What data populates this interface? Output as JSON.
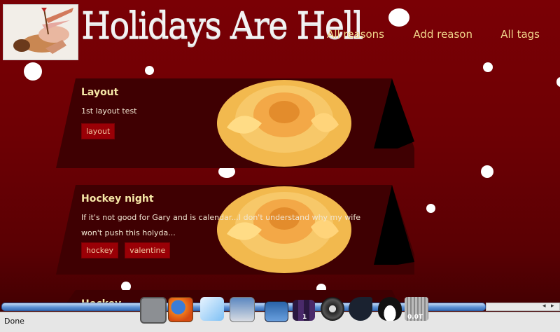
{
  "header": {
    "title": "Holidays Are Hell",
    "logo_icon": "cupid-logo-icon",
    "nav": [
      "All reasons",
      "Add reason",
      "All tags"
    ]
  },
  "reasons": [
    {
      "title": "Layout",
      "text": "1st layout test",
      "tags": [
        "layout"
      ]
    },
    {
      "title": "Hockey night",
      "text": "If it's not good for Gary and is calendar...I don't understand why my wife won't push this holyda...",
      "tags": [
        "hockey",
        "valentine"
      ]
    },
    {
      "title": "Hockey"
    }
  ],
  "statusbar": {
    "status": "Done"
  },
  "dock": {
    "items": [
      "terminal-icon",
      "firefox-icon",
      "quill-icon",
      "scanner-icon",
      "desktop-icon",
      "workspace-icon",
      "speaker-icon",
      "chat-icon",
      "linux-penguin-icon",
      "trash-icon"
    ],
    "workspace_badge": "1",
    "trash_badge": "0.0T"
  },
  "colors": {
    "background": "#6e0004",
    "title": "#f6e7a6",
    "nav": "#f1d58b",
    "tag": "#9a0006"
  }
}
